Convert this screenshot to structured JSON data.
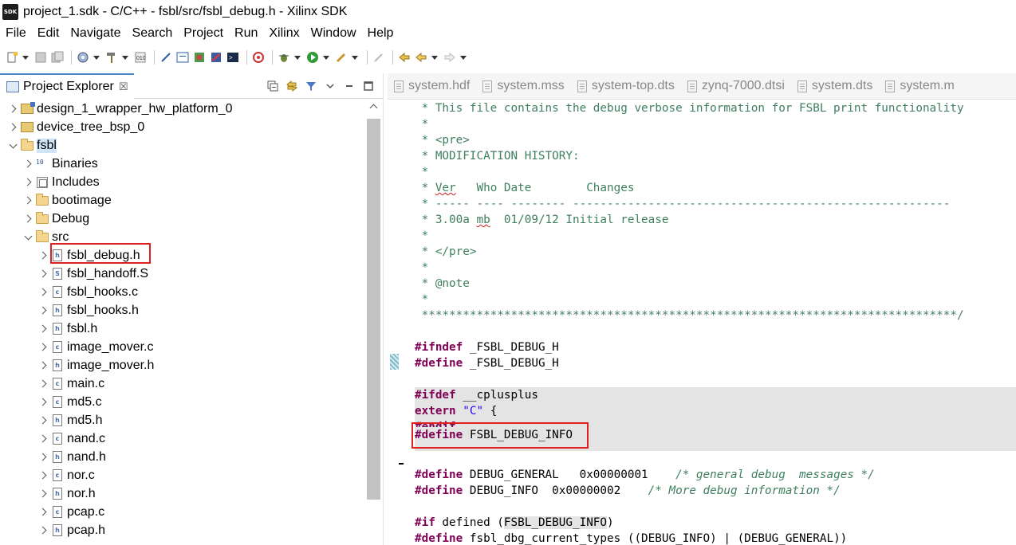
{
  "window": {
    "app_icon_label": "SDK",
    "title": "project_1.sdk - C/C++ - fsbl/src/fsbl_debug.h - Xilinx SDK"
  },
  "menu": {
    "items": [
      "File",
      "Edit",
      "Navigate",
      "Search",
      "Project",
      "Run",
      "Xilinx",
      "Window",
      "Help"
    ]
  },
  "explorer": {
    "tab_label": "Project Explorer",
    "close_glyph": "☒",
    "tree": [
      {
        "label": "design_1_wrapper_hw_platform_0",
        "icon": "project-icon",
        "chevron": "right"
      },
      {
        "label": "device_tree_bsp_0",
        "icon": "project-icon",
        "chevron": "right"
      },
      {
        "label": "fsbl",
        "icon": "c-project-icon",
        "chevron": "down"
      },
      {
        "label": "Binaries",
        "icon": "binaries-icon",
        "chevron": "right"
      },
      {
        "label": "Includes",
        "icon": "includes-icon",
        "chevron": "right"
      },
      {
        "label": "bootimage",
        "icon": "folder-icon",
        "chevron": "right"
      },
      {
        "label": "Debug",
        "icon": "folder-icon",
        "chevron": "right"
      },
      {
        "label": "src",
        "icon": "folder-open-icon",
        "chevron": "down"
      },
      {
        "label": "fsbl_debug.h",
        "icon": "h-file-icon",
        "chevron": "right"
      },
      {
        "label": "fsbl_handoff.S",
        "icon": "s-file-icon",
        "chevron": "right"
      },
      {
        "label": "fsbl_hooks.c",
        "icon": "c-file-icon",
        "chevron": "right"
      },
      {
        "label": "fsbl_hooks.h",
        "icon": "h-file-icon",
        "chevron": "right"
      },
      {
        "label": "fsbl.h",
        "icon": "h-file-icon",
        "chevron": "right"
      },
      {
        "label": "image_mover.c",
        "icon": "c-file-icon",
        "chevron": "right"
      },
      {
        "label": "image_mover.h",
        "icon": "h-file-icon",
        "chevron": "right"
      },
      {
        "label": "main.c",
        "icon": "c-file-icon",
        "chevron": "right"
      },
      {
        "label": "md5.c",
        "icon": "c-file-icon",
        "chevron": "right"
      },
      {
        "label": "md5.h",
        "icon": "h-file-icon",
        "chevron": "right"
      },
      {
        "label": "nand.c",
        "icon": "c-file-icon",
        "chevron": "right"
      },
      {
        "label": "nand.h",
        "icon": "h-file-icon",
        "chevron": "right"
      },
      {
        "label": "nor.c",
        "icon": "c-file-icon",
        "chevron": "right"
      },
      {
        "label": "nor.h",
        "icon": "h-file-icon",
        "chevron": "right"
      },
      {
        "label": "pcap.c",
        "icon": "c-file-icon",
        "chevron": "right"
      },
      {
        "label": "pcap.h",
        "icon": "h-file-icon",
        "chevron": "right"
      }
    ]
  },
  "editor": {
    "tabs": [
      "system.hdf",
      "system.mss",
      "system-top.dts",
      "zynq-7000.dtsi",
      "system.dts",
      "system.m"
    ],
    "code": {
      "l1": " * This file contains the debug verbose information for FSBL print functionality",
      "l2": " *",
      "l3": " * <pre>",
      "l4": " * MODIFICATION HISTORY:",
      "l5": " *",
      "l6a": " * ",
      "l6b": "Ver",
      "l6c": "   Who Date        Changes",
      "l7": " * ----- ---- -------- -------------------------------------------------------",
      "l8a": " * 3.00a ",
      "l8b": "mb",
      "l8c": "  01/09/12 Initial release",
      "l9": " *",
      "l10": " * </pre>",
      "l11": " *",
      "l12": " * @note",
      "l13": " *",
      "l14": " ******************************************************************************/",
      "l16_kw": "#ifndef",
      "l16_rest": " _FSBL_DEBUG_H",
      "l17_kw": "#define",
      "l17_rest": " _FSBL_DEBUG_H",
      "l19_kw": "#ifdef",
      "l19_rest": " __cplusplus",
      "l20_kw": "extern",
      "l20_str": " \"C\"",
      "l20_rest": " {",
      "l21_kw": "#endif",
      "l22_kw": "#define",
      "l22_sp": " ",
      "l22_rest": "FSBL_DEBUG_INFO",
      "l24_kw": "#define",
      "l24_rest": " DEBUG_GENERAL   0x00000001    ",
      "l24_cmt": "/* general debug  messages */",
      "l25_kw": "#define",
      "l25_rest": " DEBUG_INFO  0x00000002    ",
      "l25_cmt": "/* More debug information */",
      "l27_kw": "#if",
      "l27_rest": " defined (",
      "l27_mark": "FSBL_DEBUG_INFO",
      "l27_end": ")",
      "l28_kw": "#define",
      "l28_rest": " fsbl_dbg_current_types ((DEBUG_INFO) | (DEBUG_GENERAL))"
    }
  },
  "colors": {
    "comment": "#3f7f5f",
    "keyword": "#7f0055",
    "string": "#2a00ff",
    "highlight_box": "#e02020",
    "selection": "#cfe4f7"
  }
}
